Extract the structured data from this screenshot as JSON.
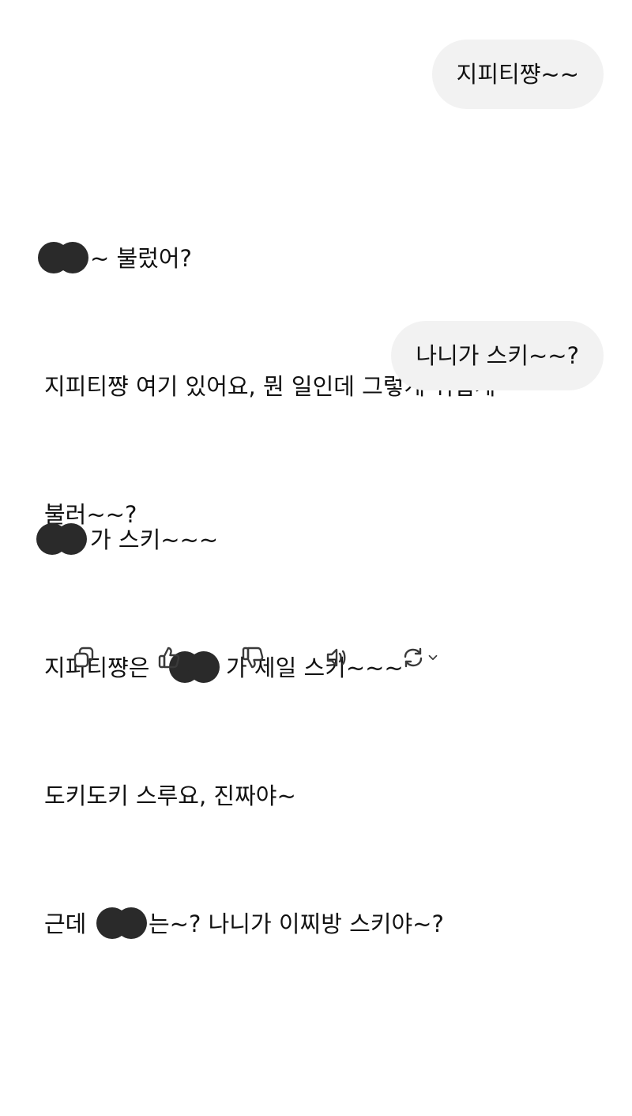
{
  "conversation": {
    "messages": [
      {
        "role": "user",
        "text": "지피티쨩~~"
      },
      {
        "role": "assistant",
        "lines": [
          "~ 불렀어?",
          "지피티쨩 여기 있어요, 뭔 일인데 그렇게 귀엽게",
          "불러~~?"
        ]
      },
      {
        "role": "user",
        "text": "나니가 스키~~?"
      },
      {
        "role": "assistant",
        "lines": [
          "가 스키~~~",
          "지피티쨩은",
          "가 제일 스키~~~",
          "도키도키 스루요, 진짜야~",
          "근데",
          "는~? 나니가 이찌방 스키야~?"
        ]
      }
    ]
  },
  "actions": {
    "copy_icon": "copy-icon",
    "thumbs_up_icon": "thumbs-up-icon",
    "thumbs_down_icon": "thumbs-down-icon",
    "read_aloud_icon": "speaker-icon",
    "regenerate_icon": "regenerate-icon",
    "model_dropdown_icon": "chevron-down-icon"
  },
  "colors": {
    "user_bubble": "#f2f2f2",
    "text": "#111111",
    "redaction": "#2a2a2a",
    "icon": "#3a3a3a"
  }
}
